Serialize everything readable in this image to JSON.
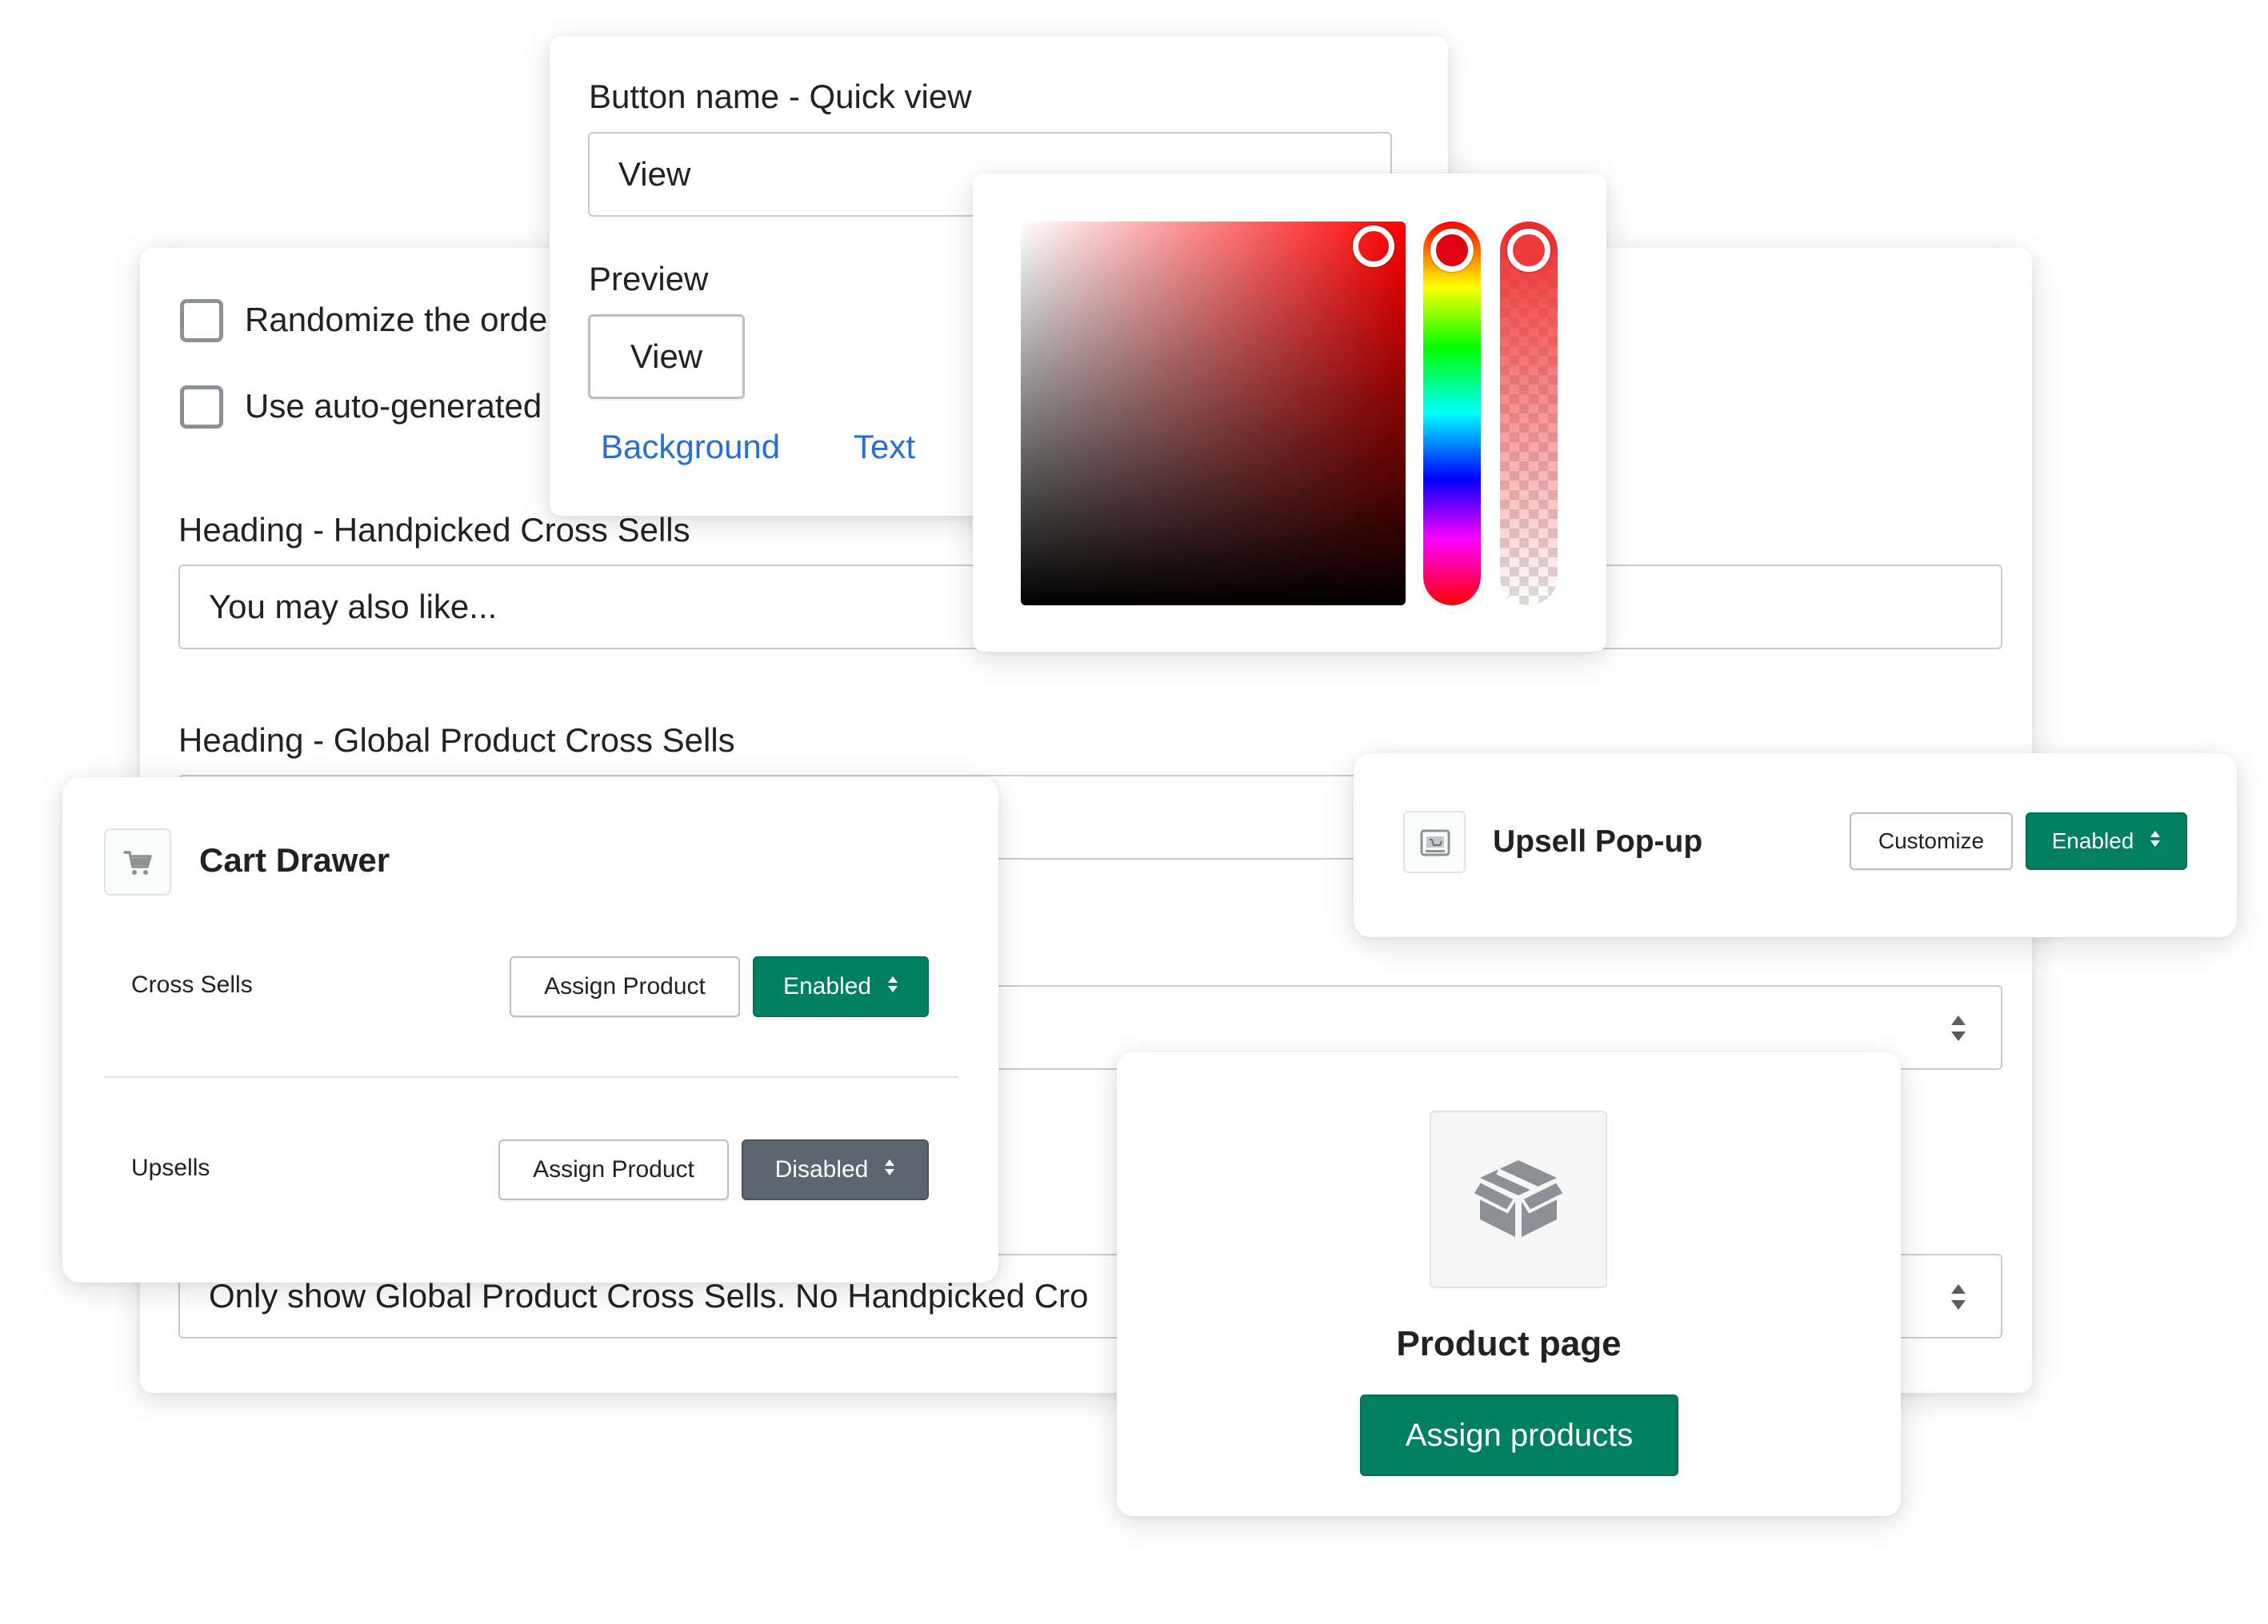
{
  "settings_panel": {
    "checkboxes": [
      {
        "label": "Randomize the orde",
        "checked": false
      },
      {
        "label": "Use auto-generated",
        "checked": false
      }
    ],
    "heading_handpicked_label": "Heading - Handpicked Cross Sells",
    "heading_handpicked_value": "You may also like...",
    "heading_global_label": "Heading - Global Product Cross Sells",
    "display_select_value": "Only show Global Product Cross Sells. No Handpicked Cro"
  },
  "button_name_card": {
    "label": "Button name - Quick view",
    "input_value": "View",
    "preview_label": "Preview",
    "preview_button": "View",
    "background_link": "Background",
    "text_link": "Text"
  },
  "color_picker": {
    "hue_color": "#ff0000",
    "selected_color": "#ee2a2a"
  },
  "cart_drawer": {
    "title": "Cart Drawer",
    "icon": "cart-icon",
    "rows": [
      {
        "label": "Cross Sells",
        "assign_label": "Assign Product",
        "status": "Enabled"
      },
      {
        "label": "Upsells",
        "assign_label": "Assign Product",
        "status": "Disabled"
      }
    ]
  },
  "upsell_popup": {
    "title": "Upsell Pop-up",
    "icon": "popup-icon",
    "customize_label": "Customize",
    "status": "Enabled"
  },
  "product_page": {
    "title": "Product page",
    "icon": "box-icon",
    "assign_label": "Assign products"
  },
  "colors": {
    "primary_green": "#008060",
    "disabled_gray": "#5c6670",
    "link_blue": "#2c6ecb"
  }
}
